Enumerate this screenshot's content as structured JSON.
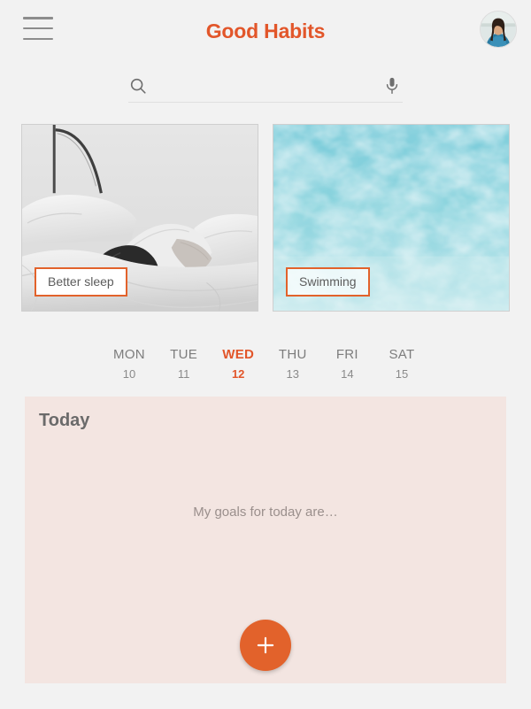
{
  "header": {
    "title": "Good Habits",
    "menu_icon": "hamburger-menu-icon",
    "avatar_alt": "user-avatar"
  },
  "search": {
    "value": "",
    "placeholder": "",
    "search_icon": "search-icon",
    "mic_icon": "microphone-icon"
  },
  "cards": [
    {
      "label": "Better sleep",
      "image": "grayscale-photo-person-sleeping-in-bed"
    },
    {
      "label": "Swimming",
      "image": "turquoise-pool-water-surface"
    }
  ],
  "days": [
    {
      "dow": "MON",
      "dom": "10",
      "active": false
    },
    {
      "dow": "TUE",
      "dom": "11",
      "active": false
    },
    {
      "dow": "WED",
      "dom": "12",
      "active": true
    },
    {
      "dow": "THU",
      "dom": "13",
      "active": false
    },
    {
      "dow": "FRI",
      "dom": "14",
      "active": false
    },
    {
      "dow": "SAT",
      "dom": "15",
      "active": false
    }
  ],
  "today": {
    "title": "Today",
    "placeholder": "My goals for today are…",
    "add_icon": "plus-icon"
  },
  "colors": {
    "accent": "#e2562a",
    "fab": "#e2622b",
    "panel_bg": "#f3e5e1",
    "page_bg": "#f2f2f2",
    "muted_text": "#7d7d7d"
  }
}
